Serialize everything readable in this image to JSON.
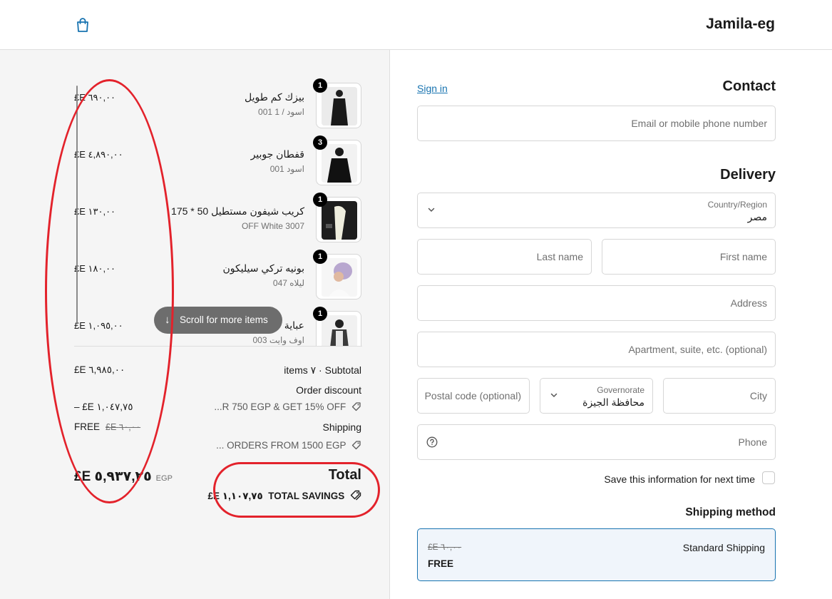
{
  "header": {
    "store_name": "Jamila-eg",
    "cart_icon": "shopping-bag-icon"
  },
  "cart": {
    "items": [
      {
        "quantity": "1",
        "name": "بيزك كم طويل",
        "variant": "001 اسود / 1",
        "price": "£E ٦٩٠,٠٠"
      },
      {
        "quantity": "3",
        "name": "قفطان جوبير",
        "variant": "001 اسود",
        "price": "£E ٤,٨٩٠,٠٠"
      },
      {
        "quantity": "1",
        "name": "كريب شيفون مستطيل 50 * 175",
        "variant": "OFF White 3007",
        "price": "£E ١٣٠,٠٠"
      },
      {
        "quantity": "1",
        "name": "بونيه تركي سيليكون",
        "variant": "047 ليلاه",
        "price": "£E ١٨٠,٠٠"
      },
      {
        "quantity": "1",
        "name": "عباية",
        "variant": "003 اوف وايت",
        "price": "£E ١,٠٩٥,٠٠"
      }
    ],
    "scroll_hint": "Scroll for more items"
  },
  "summary": {
    "subtotal_label": "items ٧ · Subtotal",
    "subtotal_value": "£E ٦,٩٨٥,٠٠",
    "discount_label": "Order discount",
    "discount_code": "...R 750 EGP & GET 15% OFF",
    "discount_value": "– £E ١,٠٤٧,٧٥",
    "shipping_label": "Shipping",
    "shipping_code": "... ORDERS FROM 1500 EGP",
    "shipping_value": "FREE",
    "shipping_old": "£E ٦٠,٠٠",
    "total_label": "Total",
    "total_currency": "EGP",
    "total_value": "£E ٥,٩٣٧,٢٥",
    "savings_label": "TOTAL SAVINGS",
    "savings_value": "£E ١,١٠٧,٧٥"
  },
  "contact": {
    "title": "Contact",
    "sign_in": "Sign in",
    "email_placeholder": "Email or mobile phone number"
  },
  "delivery": {
    "title": "Delivery",
    "country_label": "Country/Region",
    "country_value": "مصر",
    "last_name": "Last name",
    "first_name": "First name",
    "address": "Address",
    "apartment": "Apartment, suite, etc. (optional)",
    "postal": "Postal code (optional)",
    "governorate_label": "Governorate",
    "governorate_value": "محافظة الجيزة",
    "city": "City",
    "phone": "Phone",
    "save_info": "Save this information for next time"
  },
  "shipping_method": {
    "title": "Shipping method",
    "option_name": "Standard Shipping",
    "option_old_price": "£E ٦٠,٠٠",
    "option_price": "FREE"
  },
  "colors": {
    "accent": "#1773b0",
    "annotation": "#e3222b"
  }
}
